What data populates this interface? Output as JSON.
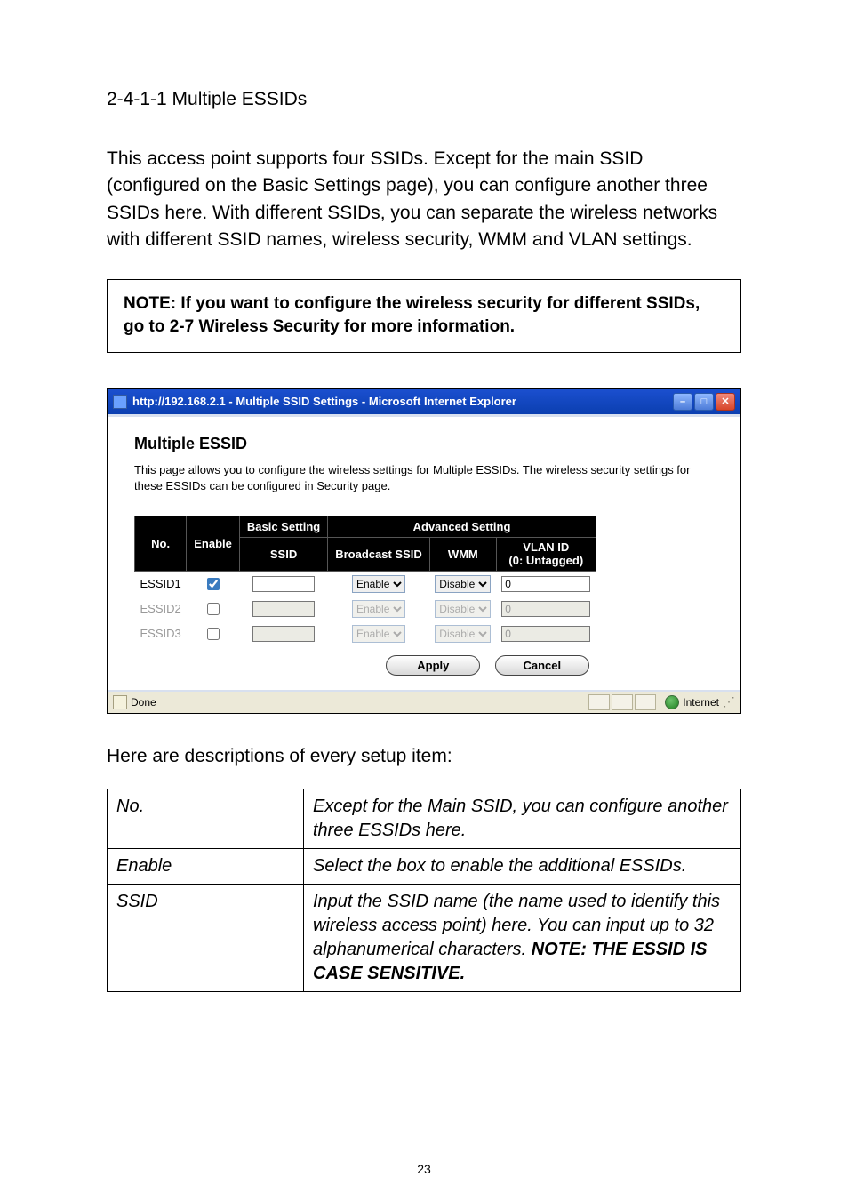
{
  "heading": "2-4-1-1 Multiple ESSIDs",
  "intro": "This access point supports four SSIDs. Except for the main SSID (configured on the Basic Settings page), you can configure another three SSIDs here. With different SSIDs, you can separate the wireless networks with different SSID names, wireless security, WMM and VLAN settings.",
  "note": "NOTE: If you want to configure the wireless security for different SSIDs, go to 2-7 Wireless Security for more information.",
  "window": {
    "title": "http://192.168.2.1 - Multiple SSID Settings - Microsoft Internet Explorer",
    "minimize": "–",
    "maximize": "□",
    "close": "✕",
    "heading": "Multiple ESSID",
    "desc": "This page allows you to configure the wireless settings for Multiple ESSIDs. The wireless security settings for these ESSIDs can be configured in Security page.",
    "table": {
      "group_basic": "Basic Setting",
      "group_advanced": "Advanced Setting",
      "col_no": "No.",
      "col_enable": "Enable",
      "col_ssid": "SSID",
      "col_broadcast": "Broadcast SSID",
      "col_wmm": "WMM",
      "col_vlan": "VLAN ID\n(0: Untagged)",
      "rows": [
        {
          "no": "ESSID1",
          "enabled": true,
          "ssid": "",
          "broadcast": "Enable",
          "wmm": "Disable",
          "vlan": "0",
          "active": true
        },
        {
          "no": "ESSID2",
          "enabled": false,
          "ssid": "",
          "broadcast": "Enable",
          "wmm": "Disable",
          "vlan": "0",
          "active": false
        },
        {
          "no": "ESSID3",
          "enabled": false,
          "ssid": "",
          "broadcast": "Enable",
          "wmm": "Disable",
          "vlan": "0",
          "active": false
        }
      ]
    },
    "apply": "Apply",
    "cancel": "Cancel",
    "status_done": "Done",
    "status_zone": "Internet"
  },
  "definitions_intro": "Here are descriptions of every setup item:",
  "definitions": [
    {
      "term": "No.",
      "desc": "Except for the Main SSID, you can configure another three ESSIDs here."
    },
    {
      "term": "Enable",
      "desc": "Select the box to enable the additional ESSIDs."
    },
    {
      "term": "SSID",
      "desc": "Input the SSID name (the name used to identify this wireless access point) here. You can input up to 32 alphanumerical characters. ",
      "strong": "NOTE: THE ESSID IS CASE SENSITIVE."
    }
  ],
  "page_number": "23"
}
